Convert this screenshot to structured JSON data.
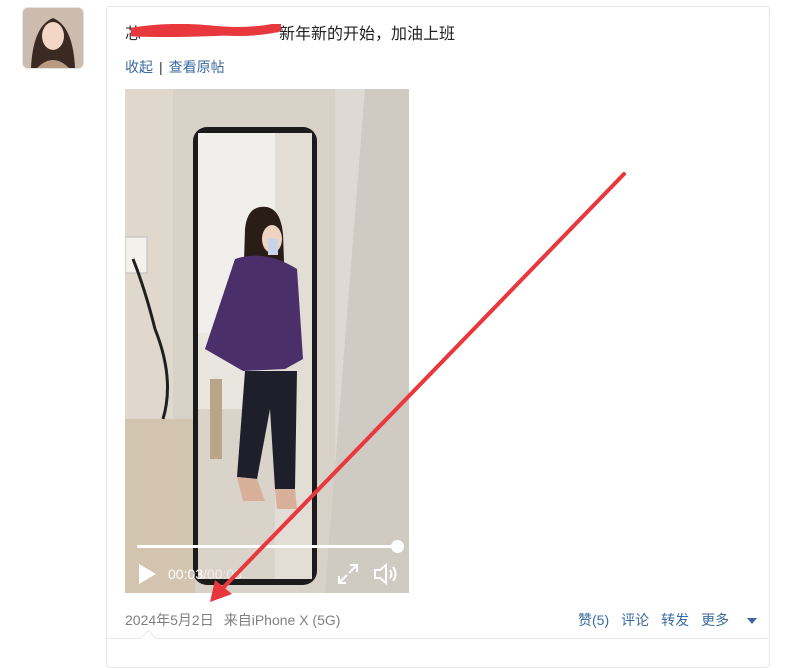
{
  "post": {
    "username": "芯",
    "text": "新年新的开始，加油上班"
  },
  "actions_top": {
    "collapse": "收起",
    "separator": "|",
    "view_original": "查看原帖"
  },
  "video": {
    "current_time": "00:03",
    "duration": "/00:03",
    "progress_fraction": 1.0
  },
  "meta": {
    "date": "2024年5月2日",
    "source": "来自iPhone X (5G)"
  },
  "bottom_actions": {
    "like": "赞(5)",
    "comment": "评论",
    "repost": "转发",
    "more": "更多"
  },
  "colors": {
    "link": "#3b6aa0",
    "meta": "#808080",
    "redaction": "#e8383d"
  }
}
